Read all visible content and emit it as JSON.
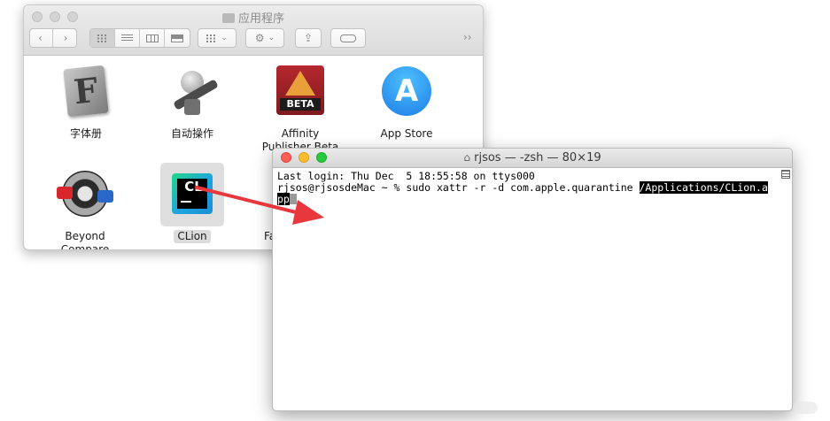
{
  "finder": {
    "title": "应用程序",
    "back_icon": "chevron-left-icon",
    "forward_icon": "chevron-right-icon",
    "more_glyph": "››",
    "items": [
      {
        "label": "字体册",
        "icon": "font-book-icon"
      },
      {
        "label": "自动操作",
        "icon": "automator-icon"
      },
      {
        "label": "Affinity Publisher Beta",
        "icon": "affinity-publisher-icon",
        "badge": "BETA"
      },
      {
        "label": "App Store",
        "icon": "app-store-icon"
      },
      {
        "label": "Beyond Compare",
        "icon": "beyond-compare-icon"
      },
      {
        "label": "CLion",
        "icon": "clion-icon",
        "icon_text": "CL"
      },
      {
        "label": "Fa",
        "icon": "app-icon"
      }
    ]
  },
  "terminal": {
    "title": "rjsos — -zsh — 80×19",
    "lines": [
      "Last login: Thu Dec  5 18:55:58 on ttys000",
      "rjsos@rjsosdeMac ~ % sudo xattr -r -d com.apple.quarantine "
    ],
    "highlight_1": "/Applications/CLion.a",
    "highlight_2": "pp"
  },
  "colors": {
    "arrow": "#e8383d",
    "terminal_bg": "#ffffff",
    "finder_toolbar": "#e3e3e3"
  }
}
